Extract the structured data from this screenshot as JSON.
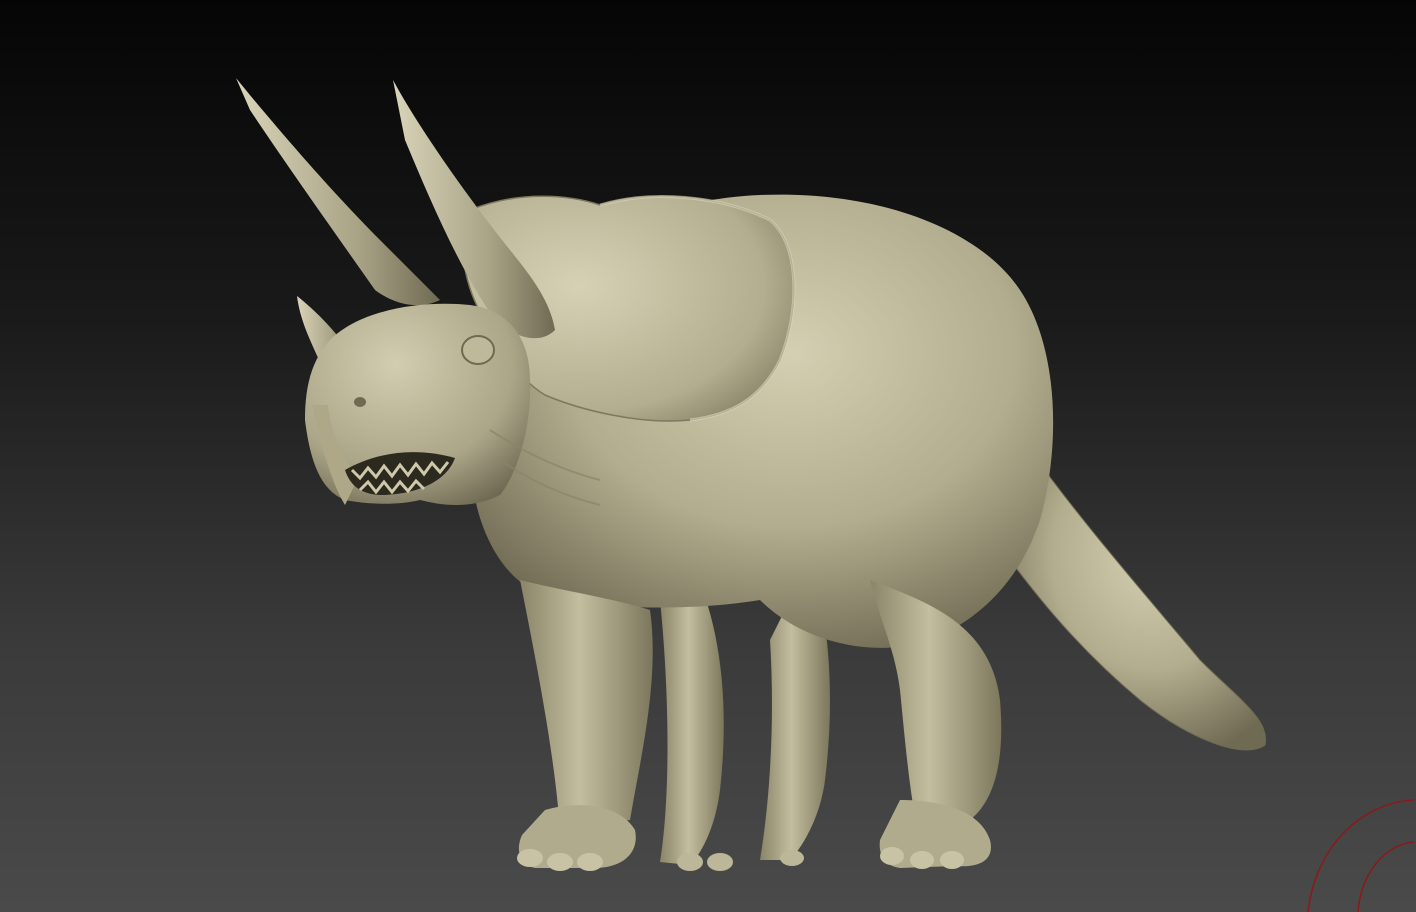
{
  "scene": {
    "background_top": "#050505",
    "background_bottom": "#4a4a4a",
    "model_name": "triceratops-sculpt",
    "material_color": "#bdb79a",
    "shadow_color": "#6f6a52",
    "highlight_color": "#d8d3b8",
    "gizmo_color": "#8a1a1a"
  }
}
